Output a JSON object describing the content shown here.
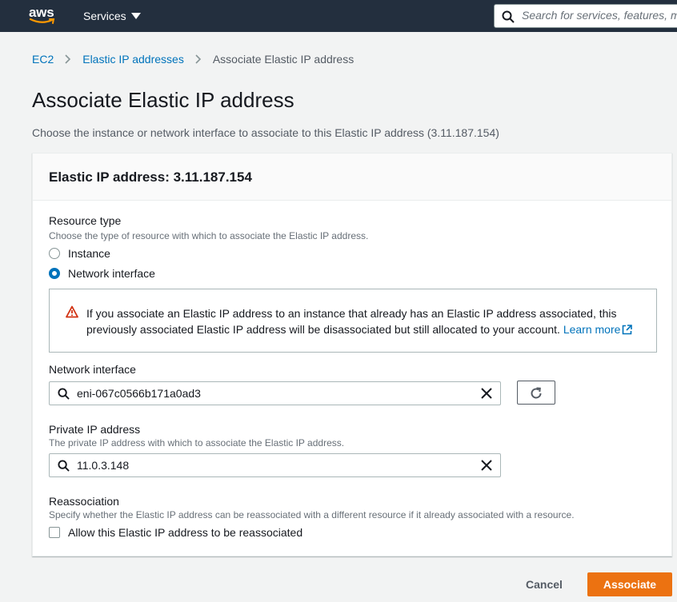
{
  "nav": {
    "logo_text": "aws",
    "services_label": "Services",
    "search_placeholder": "Search for services, features, marketplace products, and docs"
  },
  "breadcrumb": {
    "items": [
      "EC2",
      "Elastic IP addresses"
    ],
    "current": "Associate Elastic IP address"
  },
  "page": {
    "title": "Associate Elastic IP address",
    "description": "Choose the instance or network interface to associate to this Elastic IP address (3.11.187.154)"
  },
  "panel": {
    "header": "Elastic IP address: 3.11.187.154",
    "resource_type": {
      "label": "Resource type",
      "hint": "Choose the type of resource with which to associate the Elastic IP address.",
      "options": [
        "Instance",
        "Network interface"
      ],
      "selected": "Network interface"
    },
    "alert": {
      "message": "If you associate an Elastic IP address to an instance that already has an Elastic IP address associated, this previously associated Elastic IP address will be disassociated but still allocated to your account.",
      "link": "Learn more"
    },
    "network_interface": {
      "label": "Network interface",
      "value": "eni-067c0566b171a0ad3"
    },
    "private_ip": {
      "label": "Private IP address",
      "hint": "The private IP address with which to associate the Elastic IP address.",
      "value": "11.0.3.148"
    },
    "reassociation": {
      "label": "Reassociation",
      "hint": "Specify whether the Elastic IP address can be reassociated with a different resource if it already associated with a resource.",
      "checkbox_label": "Allow this Elastic IP address to be reassociated",
      "checked": false
    }
  },
  "actions": {
    "cancel": "Cancel",
    "associate": "Associate"
  },
  "colors": {
    "nav_bg": "#232f3e",
    "link": "#0073bb",
    "primary": "#ec7211",
    "warning": "#d13212"
  }
}
